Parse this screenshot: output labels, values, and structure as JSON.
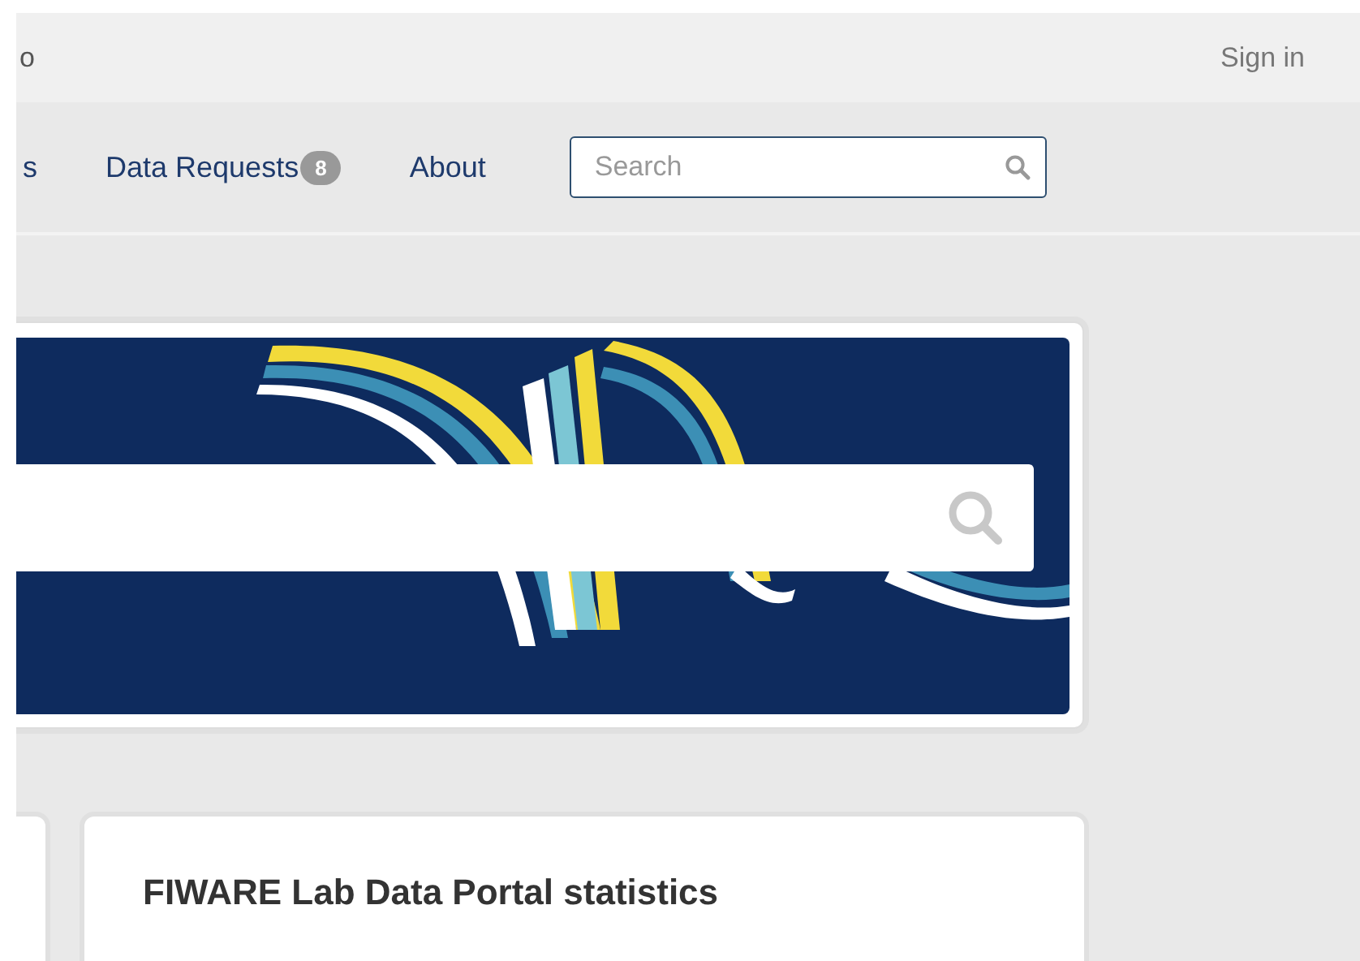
{
  "top_bar": {
    "left_text": "o",
    "sign_in": "Sign in"
  },
  "nav": {
    "items": [
      {
        "label": "s"
      },
      {
        "label": "Data Requests",
        "badge": "8"
      },
      {
        "label": "About"
      }
    ],
    "search": {
      "placeholder": "Search"
    }
  },
  "cards": [
    {
      "kind": "edge"
    },
    {
      "kind": "titled",
      "title": "FIWARE Lab Data Portal statistics"
    }
  ]
}
